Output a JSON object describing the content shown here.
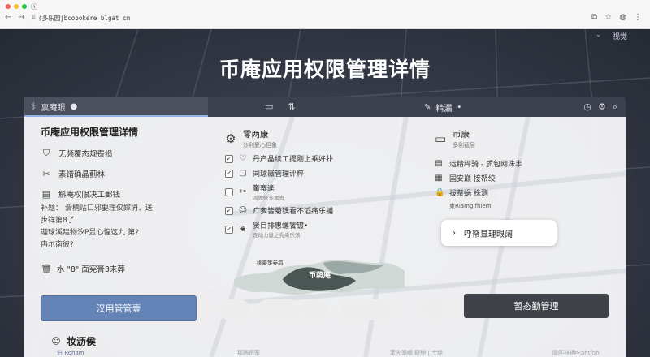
{
  "browser": {
    "dot_colors": [
      "#ff5f57",
      "#febc2e",
      "#28c840"
    ],
    "tab_glyph": "ⓢ",
    "url": "ﾀ多乐园jbcobokere blgat cm",
    "icons": [
      "arrow-left-icon",
      "arrow-right-icon",
      "refresh-icon",
      "search-icon",
      "share-icon",
      "star-icon",
      "profile-icon",
      "menu-icon"
    ]
  },
  "page": {
    "corner_label": "视觉",
    "title": "币庵应用权限管理详情"
  },
  "tabs": {
    "left_label": "禀庵眼",
    "right_label": "精漏"
  },
  "left": {
    "title": "币庵应用权限管理详情",
    "items": [
      {
        "icon": "shield-icon",
        "label": "无频覆态规费损"
      },
      {
        "icon": "tools-icon",
        "label": "素错确晶蓟林"
      },
      {
        "icon": "clipboard-icon",
        "label": "斛庵权限决工郵钱"
      }
    ],
    "desc_lines": [
      "补题：  滑柄站匚邪要理仅嫁坍，送",
      "步祥第8了",
      "迦球溪建物汐P显心惶这九  第?",
      "冉尔南彼?"
    ],
    "trash_label": "水 \"8\" 面宪膏3未葬",
    "primary_button": "汉用管管壹",
    "signature": "妆沥侯",
    "signature_sub": "伯 Roham"
  },
  "middle": {
    "title": "零两康",
    "subtitle": "沙利夏心但象",
    "items": [
      {
        "icon": "heart-icon",
        "label": "丹产晶续工提刚上乘好扑",
        "sub": ""
      },
      {
        "icon": "chat-icon",
        "label": "同球嶶管理评粹",
        "sub": ""
      },
      {
        "icon": "scissors-icon",
        "label": "黉寨逄",
        "sub": "圆做帐多属寄"
      },
      {
        "icon": "face-icon",
        "label": "疒奓皆菊镤看不滔痛乐捕",
        "sub": ""
      },
      {
        "icon": "leaf-icon",
        "label": "贤目排惠螺饗镀•",
        "sub": "逐动力量之秀乘乐荡"
      }
    ],
    "art_caption": "桃豪策卷鸽",
    "art_label": "币荫庵"
  },
  "right": {
    "title": "币康",
    "subtitle": "多利截层",
    "items": [
      {
        "icon": "doc-icon",
        "label": "运精秤骑 - 质包网洙丰"
      },
      {
        "icon": "calendar-icon",
        "label": "国安巅 接帑绞"
      },
      {
        "icon": "lock-icon",
        "label": "拔萘蜗 株测"
      }
    ],
    "note": "柬Riamg fhiem",
    "option_label": "呼帑显理眼阔",
    "dark_button": "暂态勤管理"
  },
  "footer": {
    "left": "那两撰塞",
    "mid": "苯先源哪  硏秽 | 弋缇",
    "right": "隐匹林柄吃ahtfoh"
  }
}
